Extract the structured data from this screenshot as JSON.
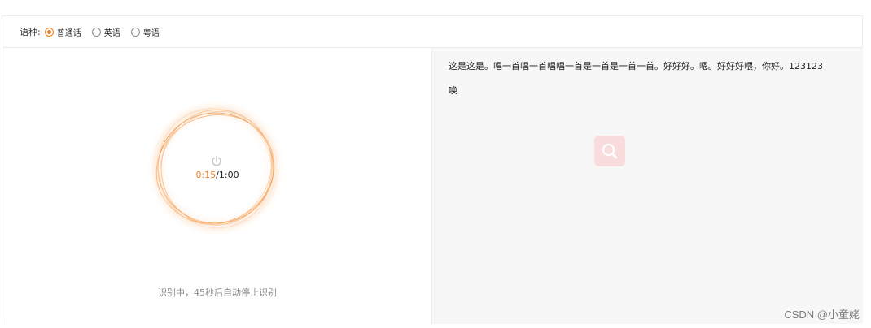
{
  "toolbar": {
    "language_label": "语种:",
    "options": [
      {
        "label": "普通话",
        "checked": true
      },
      {
        "label": "英语",
        "checked": false
      },
      {
        "label": "粤语",
        "checked": false
      }
    ],
    "accent_color": "#f07d1e"
  },
  "recorder": {
    "icon": "power-icon",
    "elapsed": "0:15",
    "separator": "/",
    "total": "1:00",
    "status": "识别中，45秒后自动停止识别"
  },
  "result": {
    "lines": [
      "这是这是。唱一首唱一首唱唱一首是一首是一首一首。好好好。嗯。好好好喂，你好。123123",
      "唤"
    ],
    "search_icon": "search-icon",
    "search_bg": "#f9dcdc"
  },
  "watermark": "CSDN @小童姥"
}
